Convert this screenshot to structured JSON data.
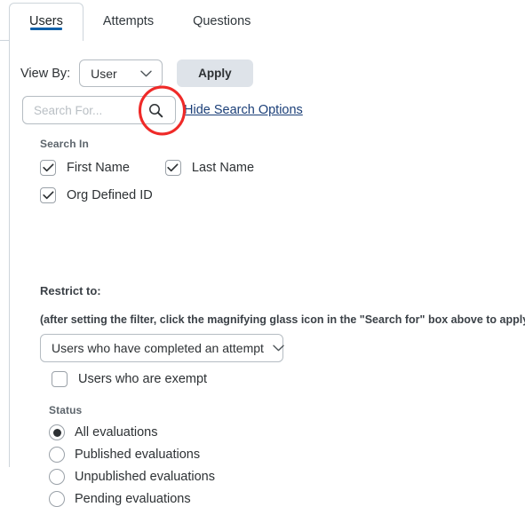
{
  "tabs": [
    {
      "label": "Users",
      "active": true
    },
    {
      "label": "Attempts",
      "active": false
    },
    {
      "label": "Questions",
      "active": false
    }
  ],
  "toolbar": {
    "view_by_label": "View By:",
    "view_by_value": "User",
    "apply_label": "Apply"
  },
  "search": {
    "placeholder": "Search For...",
    "value": "",
    "icon": "search-icon",
    "toggle_link": "Hide Search Options"
  },
  "annotation": {
    "shape": "ellipse",
    "color": "#ef2a28",
    "target": "search-icon"
  },
  "search_in": {
    "group_label": "Search In",
    "options": [
      {
        "label": "First Name",
        "checked": true
      },
      {
        "label": "Last Name",
        "checked": true
      },
      {
        "label": "Org Defined ID",
        "checked": true
      }
    ]
  },
  "restrict": {
    "title": "Restrict to:",
    "hint": "(after setting the filter, click the magnifying glass icon in the \"Search for\" box above to apply the filter)",
    "dropdown_value": "Users who have completed an attempt",
    "exempt_label": "Users who are exempt",
    "exempt_checked": false
  },
  "status": {
    "group_label": "Status",
    "options": [
      {
        "label": "All evaluations",
        "selected": true
      },
      {
        "label": "Published evaluations",
        "selected": false
      },
      {
        "label": "Unpublished evaluations",
        "selected": false
      },
      {
        "label": "Pending evaluations",
        "selected": false
      }
    ]
  },
  "colors": {
    "tab_accent": "#1060a8",
    "link": "#1b3f78",
    "annotation": "#ef2a28",
    "button_bg": "#dee3e9",
    "border": "#cdd5db"
  }
}
